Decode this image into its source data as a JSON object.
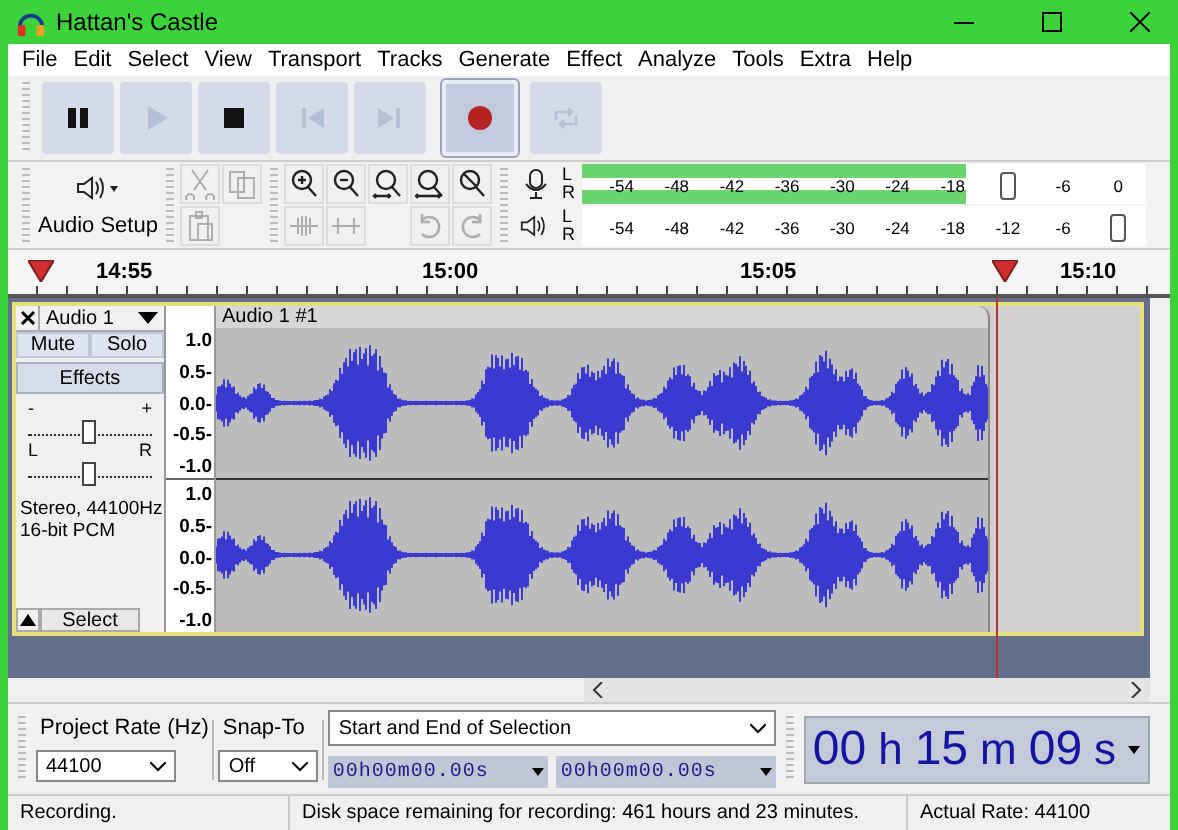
{
  "window": {
    "title": "Hattan's Castle"
  },
  "menu": [
    "File",
    "Edit",
    "Select",
    "View",
    "Transport",
    "Tracks",
    "Generate",
    "Effect",
    "Analyze",
    "Tools",
    "Extra",
    "Help"
  ],
  "transport": [
    {
      "kind": "pause",
      "disabled": false,
      "pressed": false
    },
    {
      "kind": "play",
      "disabled": true,
      "pressed": false
    },
    {
      "kind": "stop",
      "disabled": false,
      "pressed": false
    },
    {
      "kind": "skip-start",
      "disabled": true,
      "pressed": false
    },
    {
      "kind": "skip-end",
      "disabled": true,
      "pressed": false
    },
    {
      "kind": "record",
      "disabled": false,
      "pressed": true
    },
    {
      "kind": "loop",
      "disabled": true,
      "pressed": false
    }
  ],
  "audio_setup": {
    "label": "Audio Setup"
  },
  "edit_tools": [
    {
      "kind": "cut",
      "disabled": true
    },
    {
      "kind": "copy",
      "disabled": true
    },
    {
      "kind": "paste",
      "disabled": true
    }
  ],
  "audio_tools": [
    {
      "kind": "trim",
      "disabled": true
    },
    {
      "kind": "silence",
      "disabled": true
    }
  ],
  "zoom_tools": [
    {
      "kind": "zoom-in",
      "disabled": false
    },
    {
      "kind": "zoom-out",
      "disabled": false
    },
    {
      "kind": "fit-selection",
      "disabled": false
    },
    {
      "kind": "fit-project",
      "disabled": false
    },
    {
      "kind": "zoom-toggle",
      "disabled": false
    }
  ],
  "history": [
    {
      "kind": "undo",
      "disabled": true
    },
    {
      "kind": "redo",
      "disabled": true
    }
  ],
  "meters": [
    {
      "kind": "record",
      "channels": [
        {
          "label": "L",
          "level": 0.68
        },
        {
          "label": "R",
          "level": 0.68
        }
      ],
      "scale": [
        {
          "kind": "tick",
          "label": "-54"
        },
        {
          "kind": "tick",
          "label": "-48"
        },
        {
          "kind": "tick",
          "label": "-42"
        },
        {
          "kind": "tick",
          "label": "-36"
        },
        {
          "kind": "tick",
          "label": "-30"
        },
        {
          "kind": "tick",
          "label": "-24"
        },
        {
          "kind": "tick",
          "label": "-18"
        },
        {
          "kind": "slider"
        },
        {
          "kind": "tick",
          "label": "-6"
        },
        {
          "kind": "tick",
          "label": "0"
        }
      ]
    },
    {
      "kind": "playback",
      "channels": [
        {
          "label": "L"
        },
        {
          "label": "R"
        }
      ],
      "scale": [
        {
          "kind": "tick",
          "label": "-54"
        },
        {
          "kind": "tick",
          "label": "-48"
        },
        {
          "kind": "tick",
          "label": "-42"
        },
        {
          "kind": "tick",
          "label": "-36"
        },
        {
          "kind": "tick",
          "label": "-30"
        },
        {
          "kind": "tick",
          "label": "-24"
        },
        {
          "kind": "tick",
          "label": "-18"
        },
        {
          "kind": "tick",
          "label": "-12"
        },
        {
          "kind": "tick",
          "label": "-6"
        },
        {
          "kind": "slider"
        }
      ]
    }
  ],
  "ruler": {
    "ticks": [
      "14:55",
      "15:00",
      "15:05",
      "15:10"
    ]
  },
  "track": {
    "name": "Audio 1",
    "buttons": [
      "Mute",
      "Solo"
    ],
    "effects": "Effects",
    "gain": {
      "minus": "-",
      "plus": "+"
    },
    "pan": {
      "left": "L",
      "right": "R"
    },
    "info": [
      "Stereo, 44100Hz",
      "16-bit PCM"
    ],
    "select": "Select",
    "clip": "Audio 1 #1",
    "selected": true,
    "channels": [
      {
        "axis": [
          "1.0",
          "0.5-",
          "0.0-",
          "-0.5-",
          "-1.0"
        ]
      },
      {
        "axis": [
          "1.0",
          "0.5-",
          "0.0-",
          "-0.5-",
          "-1.0"
        ]
      }
    ]
  },
  "bottom": {
    "rate_label": "Project Rate (Hz)",
    "snap_label": "Snap-To",
    "rate": "44100",
    "snap": "Off",
    "selection_mode": "Start and End of Selection",
    "start": "00h00m00.00s",
    "end": "00h00m00.00s",
    "time": [
      "00",
      "h",
      "15",
      "m",
      "09",
      "s"
    ]
  },
  "status_bar": [
    "Recording.",
    "Disk space remaining for recording: 461 hours and 23 minutes.",
    "Actual Rate: 44100"
  ]
}
